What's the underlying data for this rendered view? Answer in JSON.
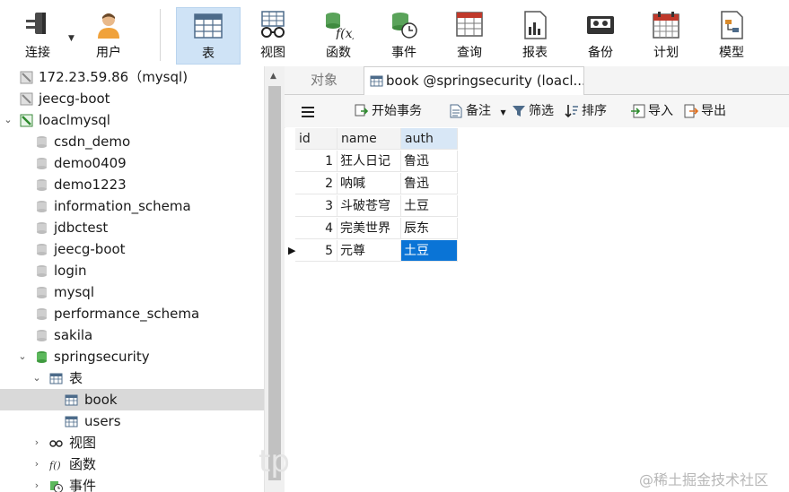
{
  "toolbar": {
    "connect": "连接",
    "user": "用户",
    "table": "表",
    "view": "视图",
    "function": "函数",
    "event": "事件",
    "query": "查询",
    "report": "报表",
    "backup": "备份",
    "schedule": "计划",
    "model": "模型"
  },
  "sidebar": {
    "items": [
      {
        "label": "172.23.59.86（mysql)"
      },
      {
        "label": "jeecg-boot"
      },
      {
        "label": "loaclmysql"
      },
      {
        "label": "csdn_demo"
      },
      {
        "label": "demo0409"
      },
      {
        "label": "demo1223"
      },
      {
        "label": "information_schema"
      },
      {
        "label": "jdbctest"
      },
      {
        "label": "jeecg-boot"
      },
      {
        "label": "login"
      },
      {
        "label": "mysql"
      },
      {
        "label": "performance_schema"
      },
      {
        "label": "sakila"
      },
      {
        "label": "springsecurity"
      },
      {
        "label": "表"
      },
      {
        "label": "book"
      },
      {
        "label": "users"
      },
      {
        "label": "视图"
      },
      {
        "label": "函数"
      },
      {
        "label": "事件"
      }
    ]
  },
  "tabs": {
    "objects": "对象",
    "book": "book @springsecurity (loacl..."
  },
  "subtoolbar": {
    "begin_tx": "开始事务",
    "notes": "备注",
    "filter": "筛选",
    "sort": "排序",
    "import": "导入",
    "export": "导出"
  },
  "grid": {
    "columns": [
      "id",
      "name",
      "auth"
    ],
    "rows": [
      [
        "1",
        "狂人日记",
        "鲁迅"
      ],
      [
        "2",
        "呐喊",
        "鲁迅"
      ],
      [
        "3",
        "斗破苍穹",
        "土豆"
      ],
      [
        "4",
        "完美世界",
        "辰东"
      ],
      [
        "5",
        "元尊",
        "土豆"
      ]
    ]
  },
  "watermark_left": "tp",
  "watermark": "@稀土掘金技术社区"
}
